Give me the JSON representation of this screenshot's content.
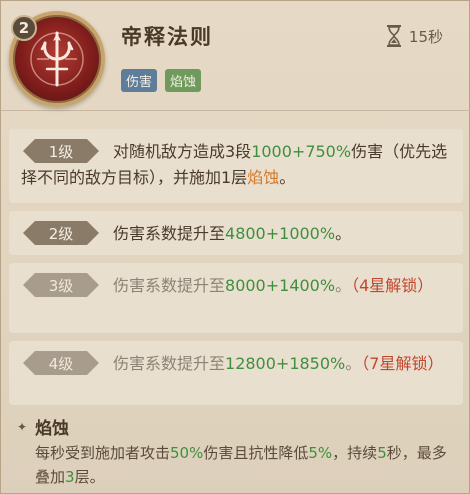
{
  "skill": {
    "number": "2",
    "name": "帝释法则",
    "cooldown": "15秒",
    "tags": [
      "伤害",
      "焰蚀"
    ]
  },
  "levels": [
    {
      "label": "1级",
      "parts": [
        "对随机敌方造成3段",
        "1000+750%",
        "伤害（优先选择不同的敌方目标），并施加1层",
        "焰蚀",
        "。"
      ]
    },
    {
      "label": "2级",
      "parts": [
        "伤害系数提升至",
        "4800+1000%",
        "。"
      ]
    },
    {
      "label": "3级",
      "parts": [
        "伤害系数提升至",
        "8000+1400%",
        "。",
        "（4星解锁）"
      ]
    },
    {
      "label": "4级",
      "parts": [
        "伤害系数提升至",
        "12800+1850%",
        "。",
        "（7星解锁）"
      ]
    }
  ],
  "effect": {
    "name": "焰蚀",
    "parts": [
      "每秒受到施加者攻击",
      "50%",
      "伤害且抗性降低",
      "5%",
      "，持续",
      "5",
      "秒，最多叠加",
      "3",
      "层。"
    ]
  },
  "colors": {
    "value_green": "#3f8f3f",
    "keyword_orange": "#d37a2b",
    "unlock_red": "#c1472e",
    "tag_damage": "#5e7d9a",
    "tag_burn": "#6f9a5c"
  },
  "icons": {
    "emblem": "trident-emblem-icon",
    "cooldown": "hourglass-icon",
    "effect_bullet": "four-point-star-icon"
  }
}
